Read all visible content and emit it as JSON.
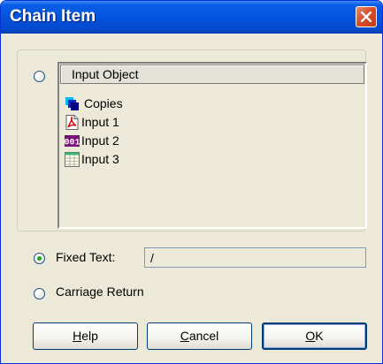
{
  "window": {
    "title": "Chain Item"
  },
  "input_object": {
    "header": "Input Object",
    "items": [
      {
        "label": "Copies",
        "icon": "copies-icon"
      },
      {
        "label": "Input 1",
        "icon": "pdf-document-icon"
      },
      {
        "label": "Input 2",
        "icon": "number-field-icon"
      },
      {
        "label": "Input 3",
        "icon": "table-icon"
      }
    ]
  },
  "fixed_text": {
    "label": "Fixed Text:",
    "value": "/"
  },
  "carriage_return": {
    "label": "Carriage Return"
  },
  "selected_option": "fixed_text",
  "buttons": {
    "help": {
      "mnemonic": "H",
      "rest": "elp"
    },
    "cancel": {
      "mnemonic": "C",
      "rest": "ancel"
    },
    "ok": {
      "mnemonic": "O",
      "rest": "K"
    }
  },
  "colors": {
    "titlebar": "#0453dd",
    "dialog_bg": "#ece9d8",
    "radio_dot": "#21a121",
    "close": "#d9502c"
  }
}
